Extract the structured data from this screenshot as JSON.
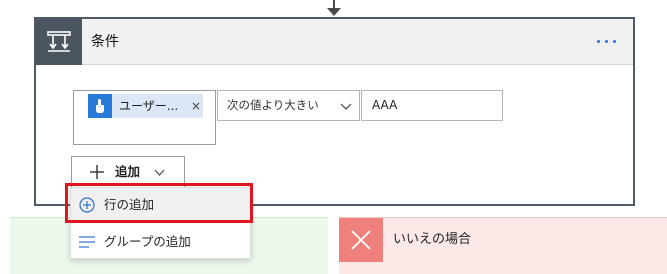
{
  "condition_card": {
    "title": "条件",
    "icon": "condition-icon",
    "more_icon": "more-options-icon",
    "header_bg": "#f1f1f1",
    "icon_bg": "#4a5560"
  },
  "condition_row": {
    "left_token": {
      "label": "ユーザー...",
      "remove": "×",
      "icon": "touch-trigger-icon",
      "icon_bg": "#2979d8"
    },
    "operator": {
      "label": "次の値より大きい",
      "icon": "chevron-down-icon"
    },
    "right_value": "AAA"
  },
  "add_button": {
    "label": "追加",
    "icon": "plus-icon",
    "chevron": "chevron-down-icon"
  },
  "add_menu": {
    "items": [
      {
        "label": "行の追加",
        "icon": "add-circle-icon"
      },
      {
        "label": "グループの追加",
        "icon": "group-lines-icon"
      }
    ],
    "highlight_color": "#e0141e"
  },
  "branches": {
    "no": {
      "label": "いいえの場合",
      "icon": "close-icon",
      "icon_bg": "#f0807c"
    },
    "yes_bg": "#edf8ec",
    "no_bg": "#fde8e8"
  }
}
